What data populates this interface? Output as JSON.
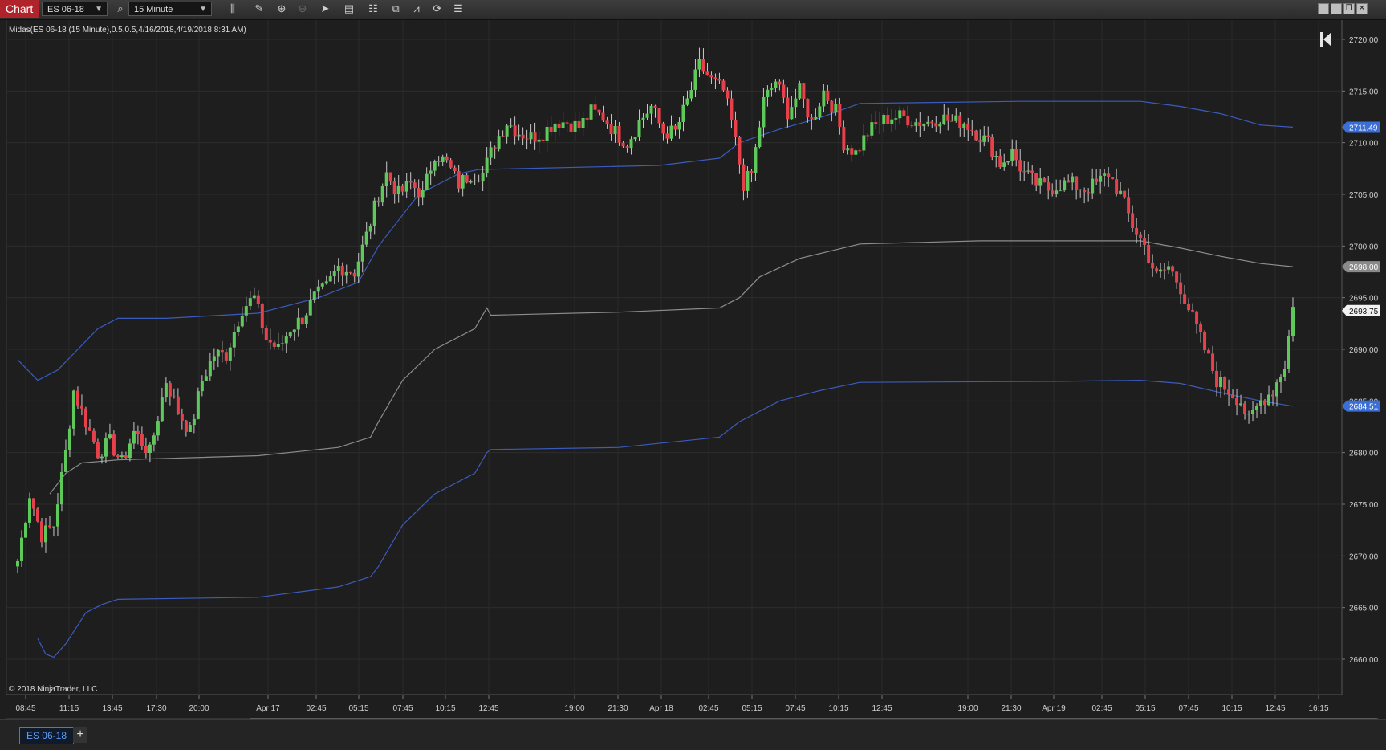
{
  "window": {
    "title": "Chart"
  },
  "toolbar": {
    "instrument": "ES 06-18",
    "interval": "15 Minute"
  },
  "icons": [
    "search-icon",
    "bar-type-icon",
    "pencil-icon",
    "zoom-in-icon",
    "zoom-out-icon",
    "pointer-icon",
    "properties-icon",
    "data-box-icon",
    "strategies-icon",
    "drawing-tools-icon",
    "reload-icon",
    "indicator-list-icon",
    "minimize-icon",
    "maximize-icon",
    "restore-icon",
    "close-icon",
    "scroll-to-end-icon"
  ],
  "indicator_label": "Midas(ES 06-18 (15 Minute),0.5,0.5,4/16/2018,4/19/2018 8:31 AM)",
  "copyright": "© 2018 NinjaTrader, LLC",
  "tab": {
    "label": "ES 06-18",
    "add": "+"
  },
  "colors": {
    "background": "#1e1e1e",
    "up": "#5ec95a",
    "down": "#e8404a",
    "band": "#3b5bbd",
    "midline": "#8c8c8c",
    "tag_blue": "#3b6fd6"
  },
  "chart_data": {
    "type": "candlestick",
    "title": "",
    "ylim": [
      2656,
      2722
    ],
    "y_ticks": [
      2660,
      2665,
      2670,
      2675,
      2680,
      2685,
      2690,
      2695,
      2700,
      2705,
      2710,
      2715,
      2720
    ],
    "y_tick_labels": [
      "2660.00",
      "2665.00",
      "2670.00",
      "2675.00",
      "2680.00",
      "2685.00",
      "2690.00",
      "2695.00",
      "2700.00",
      "2705.00",
      "2710.00",
      "2715.00",
      "2720.00"
    ],
    "x_tick_labels": [
      "08:45",
      "11:15",
      "13:45",
      "17:30",
      "20:00",
      "Apr 17",
      "02:45",
      "05:15",
      "07:45",
      "10:15",
      "12:45",
      "19:00",
      "21:30",
      "Apr 18",
      "02:45",
      "05:15",
      "07:45",
      "10:15",
      "12:45",
      "19:00",
      "21:30",
      "Apr 19",
      "02:45",
      "05:15",
      "07:45",
      "10:15",
      "12:45",
      "16:15"
    ],
    "price_tags": [
      {
        "label": "2711.49",
        "value": 2711.49,
        "style": "blue"
      },
      {
        "label": "2698.00",
        "value": 2698.0,
        "style": "gray"
      },
      {
        "label": "2693.75",
        "value": 2693.75,
        "style": "white"
      },
      {
        "label": "2684.51",
        "value": 2684.51,
        "style": "blue"
      }
    ],
    "close_anchors": [
      [
        0,
        2669.5
      ],
      [
        3,
        2676
      ],
      [
        6,
        2672
      ],
      [
        9,
        2673
      ],
      [
        12,
        2680
      ],
      [
        14,
        2686
      ],
      [
        17,
        2683
      ],
      [
        20,
        2680
      ],
      [
        23,
        2681
      ],
      [
        26,
        2679
      ],
      [
        29,
        2682
      ],
      [
        33,
        2680
      ],
      [
        37,
        2687
      ],
      [
        40,
        2684
      ],
      [
        43,
        2682
      ],
      [
        46,
        2687
      ],
      [
        49,
        2689.5
      ],
      [
        52,
        2689.5
      ],
      [
        56,
        2694
      ],
      [
        59,
        2695
      ],
      [
        62,
        2691
      ],
      [
        65,
        2690
      ],
      [
        68,
        2692
      ],
      [
        71,
        2693
      ],
      [
        74,
        2695
      ],
      [
        77,
        2696
      ],
      [
        80,
        2698
      ],
      [
        84,
        2697.5
      ],
      [
        87,
        2701
      ],
      [
        90,
        2705
      ],
      [
        92,
        2707
      ],
      [
        95,
        2705
      ],
      [
        98,
        2706
      ],
      [
        101,
        2705
      ],
      [
        104,
        2709
      ],
      [
        107,
        2708
      ],
      [
        110,
        2706
      ],
      [
        113,
        2707
      ],
      [
        116,
        2707
      ],
      [
        119,
        2710
      ],
      [
        122,
        2712
      ],
      [
        125,
        2711
      ],
      [
        128,
        2710.5
      ],
      [
        131,
        2711
      ],
      [
        134,
        2712
      ],
      [
        137,
        2712
      ],
      [
        140,
        2711.5
      ],
      [
        143,
        2713
      ],
      [
        146,
        2712.5
      ],
      [
        149,
        2711
      ],
      [
        152,
        2710
      ],
      [
        155,
        2712
      ],
      [
        158,
        2713.5
      ],
      [
        161,
        2711
      ],
      [
        164,
        2711
      ],
      [
        167,
        2714
      ],
      [
        170,
        2717.5
      ],
      [
        173,
        2716
      ],
      [
        176,
        2715
      ],
      [
        178,
        2712
      ],
      [
        181,
        2706
      ],
      [
        183,
        2707
      ],
      [
        186,
        2714
      ],
      [
        189,
        2716
      ],
      [
        192,
        2713
      ],
      [
        195,
        2715
      ],
      [
        198,
        2712
      ],
      [
        201,
        2715
      ],
      [
        204,
        2713
      ],
      [
        206,
        2710
      ],
      [
        209,
        2709
      ],
      [
        212,
        2711
      ],
      [
        215,
        2712
      ],
      [
        218,
        2712.5
      ],
      [
        221,
        2712.5
      ],
      [
        224,
        2712
      ],
      [
        227,
        2712
      ],
      [
        230,
        2712.5
      ],
      [
        233,
        2712
      ],
      [
        236,
        2712
      ],
      [
        239,
        2711
      ],
      [
        242,
        2710
      ],
      [
        245,
        2708
      ],
      [
        248,
        2709
      ],
      [
        251,
        2707
      ],
      [
        254,
        2706
      ],
      [
        257,
        2705.5
      ],
      [
        260,
        2706
      ],
      [
        263,
        2706
      ],
      [
        266,
        2705.5
      ],
      [
        269,
        2706
      ],
      [
        272,
        2707
      ],
      [
        275,
        2705
      ],
      [
        278,
        2702
      ],
      [
        281,
        2700
      ],
      [
        284,
        2697
      ],
      [
        287,
        2698
      ],
      [
        290,
        2696
      ],
      [
        293,
        2693
      ],
      [
        296,
        2690
      ],
      [
        299,
        2687
      ],
      [
        302,
        2686
      ],
      [
        305,
        2685
      ],
      [
        307,
        2683
      ],
      [
        310,
        2685
      ],
      [
        313,
        2686
      ],
      [
        316,
        2688.5
      ],
      [
        318,
        2694
      ]
    ],
    "midas_series": [
      {
        "name": "upper band",
        "points": [
          [
            0,
            2689
          ],
          [
            5,
            2687
          ],
          [
            10,
            2688
          ],
          [
            15,
            2690
          ],
          [
            20,
            2692
          ],
          [
            25,
            2693
          ],
          [
            37,
            2693
          ],
          [
            60,
            2693.5
          ],
          [
            75,
            2695
          ],
          [
            85,
            2696.5
          ],
          [
            90,
            2700
          ],
          [
            100,
            2705
          ],
          [
            110,
            2707
          ],
          [
            115,
            2707.4
          ],
          [
            160,
            2707.8
          ],
          [
            175,
            2708.5
          ],
          [
            180,
            2710
          ],
          [
            190,
            2711.3
          ],
          [
            200,
            2712.4
          ],
          [
            210,
            2713.8
          ],
          [
            250,
            2714
          ],
          [
            280,
            2714
          ],
          [
            290,
            2713.5
          ],
          [
            300,
            2712.8
          ],
          [
            310,
            2711.7
          ],
          [
            318,
            2711.5
          ]
        ]
      },
      {
        "name": "midline",
        "points": [
          [
            8,
            2676
          ],
          [
            12,
            2678
          ],
          [
            16,
            2679
          ],
          [
            25,
            2679.3
          ],
          [
            60,
            2679.7
          ],
          [
            80,
            2680.5
          ],
          [
            88,
            2681.5
          ],
          [
            90,
            2683
          ],
          [
            96,
            2687
          ],
          [
            104,
            2690
          ],
          [
            114,
            2692
          ],
          [
            117,
            2694
          ],
          [
            118,
            2693.3
          ],
          [
            150,
            2693.6
          ],
          [
            175,
            2694
          ],
          [
            180,
            2695
          ],
          [
            185,
            2697
          ],
          [
            195,
            2698.8
          ],
          [
            210,
            2700.2
          ],
          [
            240,
            2700.5
          ],
          [
            280,
            2700.5
          ],
          [
            290,
            2699.8
          ],
          [
            300,
            2699
          ],
          [
            310,
            2698.3
          ],
          [
            318,
            2698
          ]
        ]
      },
      {
        "name": "lower band",
        "points": [
          [
            5,
            2662
          ],
          [
            7,
            2660.5
          ],
          [
            9,
            2660.2
          ],
          [
            12,
            2661.5
          ],
          [
            17,
            2664.5
          ],
          [
            21,
            2665.3
          ],
          [
            25,
            2665.8
          ],
          [
            60,
            2666
          ],
          [
            80,
            2667
          ],
          [
            88,
            2668
          ],
          [
            90,
            2669
          ],
          [
            96,
            2673
          ],
          [
            104,
            2676
          ],
          [
            114,
            2678
          ],
          [
            117,
            2680
          ],
          [
            118,
            2680.3
          ],
          [
            150,
            2680.5
          ],
          [
            175,
            2681.5
          ],
          [
            180,
            2683
          ],
          [
            190,
            2685
          ],
          [
            200,
            2686
          ],
          [
            210,
            2686.8
          ],
          [
            260,
            2686.9
          ],
          [
            280,
            2687
          ],
          [
            290,
            2686.7
          ],
          [
            300,
            2685.8
          ],
          [
            310,
            2685
          ],
          [
            318,
            2684.5
          ]
        ]
      }
    ]
  }
}
